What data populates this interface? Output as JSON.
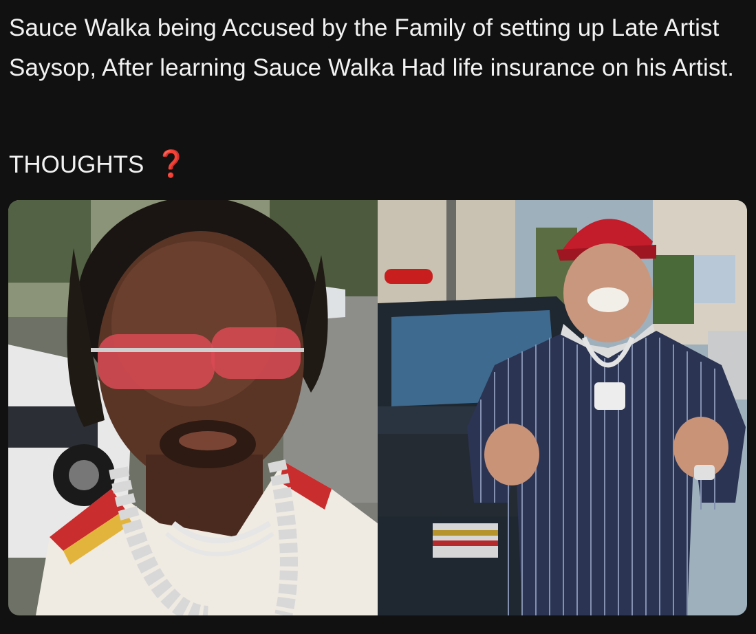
{
  "post": {
    "body_text": "Sauce Walka being Accused by the Family of setting up Late Artist Saysop, After learning Sauce Walka Had life insurance on his Artist.",
    "thoughts_label": "THOUGHTS",
    "thoughts_emoji": "❓"
  },
  "media": {
    "left_photo_icon": "photo-selfie-man-red-sunglasses",
    "right_photo_icon": "photo-man-red-cap-striped-tracksuit",
    "left_photo_logo_text": "",
    "right_photo_logo_text": ""
  },
  "colors": {
    "background": "#111111",
    "text": "#f2f2f2",
    "question_mark": "#e01e1e"
  }
}
